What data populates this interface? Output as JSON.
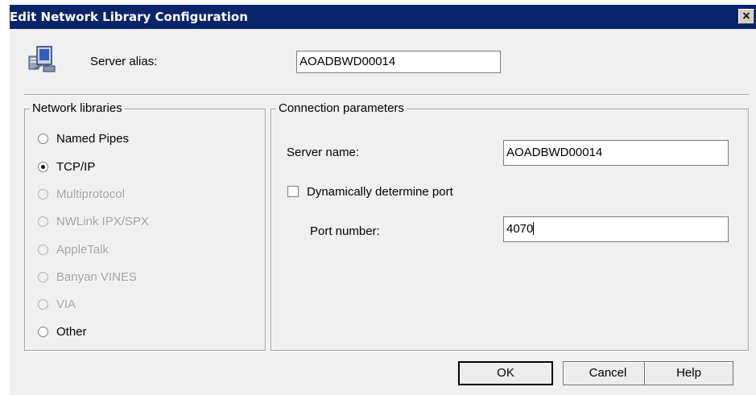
{
  "window": {
    "title": "Edit Network Library Configuration",
    "close_glyph": "×"
  },
  "server_alias": {
    "label": "Server alias:",
    "value": "AOADBWD00014"
  },
  "network_libraries": {
    "legend": "Network libraries",
    "options": [
      {
        "label": "Named Pipes",
        "checked": false,
        "enabled": true
      },
      {
        "label": "TCP/IP",
        "checked": true,
        "enabled": true
      },
      {
        "label": "Multiprotocol",
        "checked": false,
        "enabled": false
      },
      {
        "label": "NWLink IPX/SPX",
        "checked": false,
        "enabled": false
      },
      {
        "label": "AppleTalk",
        "checked": false,
        "enabled": false
      },
      {
        "label": "Banyan VINES",
        "checked": false,
        "enabled": false
      },
      {
        "label": "VIA",
        "checked": false,
        "enabled": false
      },
      {
        "label": "Other",
        "checked": false,
        "enabled": true
      }
    ]
  },
  "connection_parameters": {
    "legend": "Connection parameters",
    "server_name_label": "Server name:",
    "server_name_value": "AOADBWD00014",
    "dynamic_port_label": "Dynamically determine port",
    "dynamic_port_checked": false,
    "port_label": "Port number:",
    "port_value": "4070"
  },
  "buttons": {
    "ok": "OK",
    "cancel": "Cancel",
    "help": "Help"
  },
  "icons": {
    "app": "network-config-icon",
    "close": "close-icon"
  },
  "colors": {
    "titlebar": "#0a246a",
    "dialog_bg": "#f0f0f0"
  }
}
